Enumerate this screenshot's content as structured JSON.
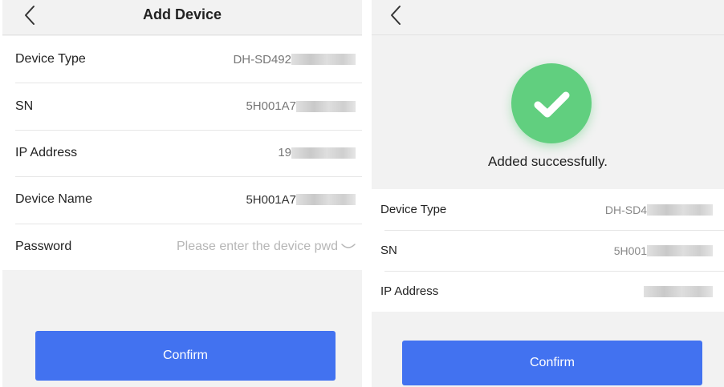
{
  "left_screen": {
    "title": "Add Device",
    "fields": [
      {
        "label": "Device Type",
        "value": "DH-SD492"
      },
      {
        "label": "SN",
        "value": "5H001A7"
      },
      {
        "label": "IP Address",
        "value": "19"
      },
      {
        "label": "Device Name",
        "value": "5H001A7"
      }
    ],
    "password": {
      "label": "Password",
      "placeholder": "Please enter the device pwd",
      "value": ""
    },
    "confirm_label": "Confirm"
  },
  "right_screen": {
    "success_message": "Added successfully.",
    "fields": [
      {
        "label": "Device Type",
        "value": "DH-SD4"
      },
      {
        "label": "SN",
        "value": "5H001"
      },
      {
        "label": "IP Address",
        "value": ""
      }
    ],
    "confirm_label": "Confirm"
  },
  "colors": {
    "accent": "#4272f0",
    "success": "#61cf7f",
    "background": "#f2f2f2"
  },
  "icons": [
    "chevron-left-icon",
    "eye-closed-icon",
    "checkmark-icon"
  ]
}
